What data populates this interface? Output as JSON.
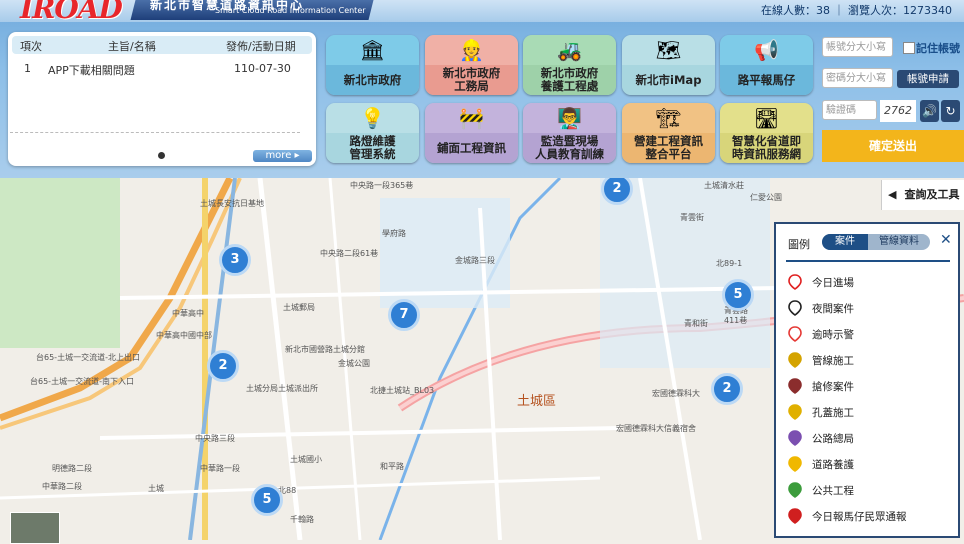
{
  "header": {
    "logo": "IROAD",
    "brand_zh": "新北市智慧道路資訊中心",
    "brand_en": "Smart Cloud Road Information Center",
    "online_label": "在線人數：38 ｜ 瀏覽人次：1273340"
  },
  "announcements": {
    "col_index": "項次",
    "col_title": "主旨/名稱",
    "col_date": "發佈/活動日期",
    "rows": [
      {
        "index": "1",
        "title": "APP下載相關問題",
        "date": "110-07-30"
      }
    ],
    "more_label": "more ▸"
  },
  "tiles": [
    {
      "label": "新北市政府",
      "icon": "city-hall-icon",
      "glyph": "🏛"
    },
    {
      "label": "新北市政府\n工務局",
      "icon": "worker-icon",
      "glyph": "👷"
    },
    {
      "label": "新北市政府\n養護工程處",
      "icon": "excavator-icon",
      "glyph": "🚜"
    },
    {
      "label": "新北市iMap",
      "icon": "map-icon",
      "glyph": "🗺"
    },
    {
      "label": "路平報馬仔",
      "icon": "megaphone-icon",
      "glyph": "📢"
    },
    {
      "label": "路燈維護\n管理系統",
      "icon": "streetlight-icon",
      "glyph": "💡"
    },
    {
      "label": "鋪面工程資訊",
      "icon": "road-roller-icon",
      "glyph": "🚧"
    },
    {
      "label": "監造暨現場\n人員教育訓練",
      "icon": "training-icon",
      "glyph": "👨‍🏫"
    },
    {
      "label": "營建工程資訊\n整合平台",
      "icon": "construction-icon",
      "glyph": "🏗"
    },
    {
      "label": "智慧化省道即\n時資訊服務網",
      "icon": "highway-icon",
      "glyph": "🛣"
    }
  ],
  "login": {
    "account_placeholder": "帳號分大小寫",
    "password_placeholder": "密碼分大小寫",
    "captcha_placeholder": "驗證碼",
    "captcha_text": "2762",
    "remember_label": "記住帳號",
    "apply_label": "帳號申請",
    "submit_label": "確定送出"
  },
  "map": {
    "district": "土城區",
    "clusters": [
      "2",
      "3",
      "7",
      "5",
      "2",
      "2",
      "5"
    ],
    "labels": [
      "中央路一段365巷",
      "土城清水莊",
      "仁愛公園",
      "青雲街",
      "北89-1",
      "青雲路",
      "411巷",
      "青和街",
      "中央路二段61巷",
      "學府路",
      "金城路三段",
      "土城長安抗日基地",
      "中華高中",
      "中華高中國中部",
      "土城郵局",
      "新北市國營路土城分館",
      "金城公園",
      "土城分局土城派出所",
      "北捷土城站_BL03",
      "中華路一段",
      "宏國德霖科大",
      "宏國德霖科大信義宿舍",
      "中央路三段",
      "和平路",
      "土城國小",
      "千翰路",
      "台65-土城一交流道-北上出口",
      "台65-土城一交流道-南下入口",
      "中華路二段",
      "明德路二段",
      "北88",
      "土城"
    ],
    "tools_label": "查詢及工具"
  },
  "legend": {
    "title": "圖例",
    "tab_cases": "案件",
    "tab_pipes": "管線資料",
    "items": [
      {
        "label": "今日進場",
        "icon": "pin-red-outline-icon",
        "color": "#e02020"
      },
      {
        "label": "夜間案件",
        "icon": "pin-black-outline-icon",
        "color": "#222222"
      },
      {
        "label": "逾時示警",
        "icon": "pin-red-icon",
        "color": "#e53935"
      },
      {
        "label": "管線施工",
        "icon": "pipeline-pin-icon",
        "color": "#d4a300"
      },
      {
        "label": "搶修案件",
        "icon": "repair-pin-icon",
        "color": "#8b2d2d"
      },
      {
        "label": "孔蓋施工",
        "icon": "manhole-pin-icon",
        "color": "#e0b000"
      },
      {
        "label": "公路總局",
        "icon": "highway-bureau-pin-icon",
        "color": "#7b4fb0"
      },
      {
        "label": "道路養護",
        "icon": "maintenance-pin-icon",
        "color": "#f0b800"
      },
      {
        "label": "公共工程",
        "icon": "public-works-pin-icon",
        "color": "#3c9c3c"
      },
      {
        "label": "今日報馬仔民眾通報",
        "icon": "citizen-report-pin-icon",
        "color": "#d01f1f"
      }
    ]
  }
}
